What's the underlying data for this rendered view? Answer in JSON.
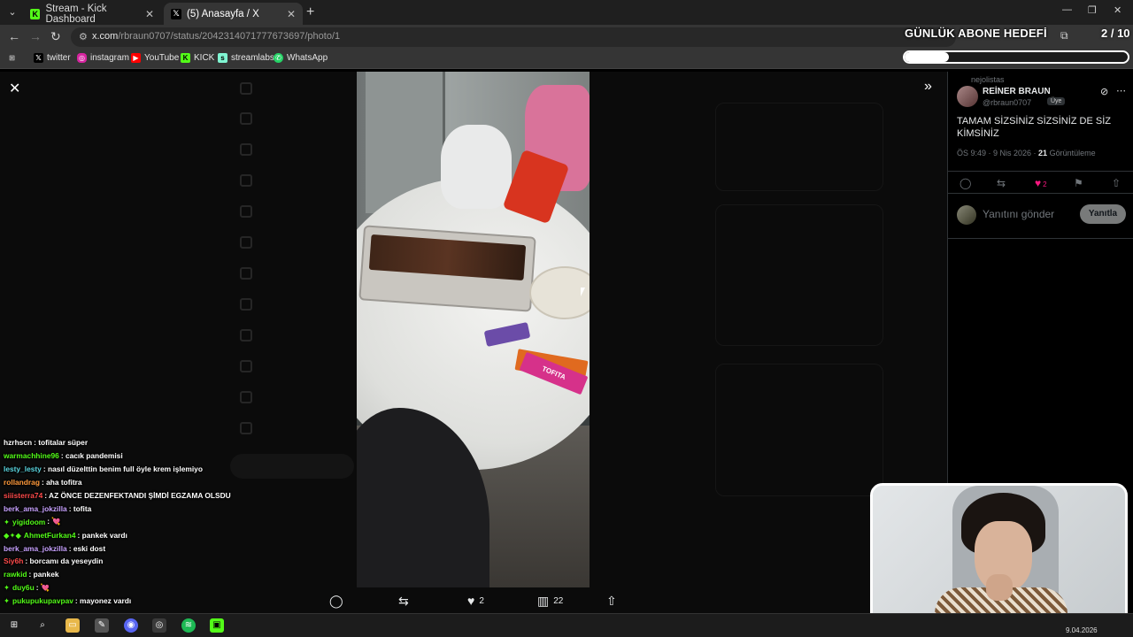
{
  "browser": {
    "tabs": [
      {
        "label": "Stream - Kick Dashboard",
        "favicon": "kick-icon",
        "active": false
      },
      {
        "label": "(5) Anasayfa / X",
        "favicon": "x-icon",
        "active": true
      }
    ],
    "url_prefix": "x.com",
    "url_path": "/rbraun0707/status/2042314071777673697/photo/1",
    "bookmarks": [
      "twitter",
      "instagram",
      "YouTube",
      "KICK",
      "streamlabs",
      "WhatsApp"
    ]
  },
  "overlay": {
    "goal_title": "GÜNLÜK ABONE HEDEFİ",
    "goal_count": "2 / 10",
    "goal_progress": 0.2
  },
  "tweet": {
    "reposted_by": "nejolistas",
    "author_name": "REİNER BRAUN",
    "author_handle": "@rbraun0707",
    "badge": "Üye",
    "text": "TAMAM SİZSİNİZ SİZSİNİZ DE SİZ KİMSİNİZ",
    "time": "ÖS 9:49 · 9 Nis 2026 · ",
    "views_count": "21",
    "views_label": " Görüntüleme",
    "likes": "2",
    "reply_placeholder": "Yanıtını gönder",
    "reply_button": "Yanıtla"
  },
  "photo_actions": {
    "likes": "2",
    "views": "22"
  },
  "chat": [
    {
      "user": "hzrhscn",
      "color": "#ffffff",
      "msg": ": tofitalar süper",
      "prefix": ""
    },
    {
      "user": "warmachhine96",
      "color": "#53fc18",
      "msg": ": cacık pandemisi",
      "prefix": ""
    },
    {
      "user": "lesty_lesty",
      "color": "#5ad6e0",
      "msg": ": nasıl düzelttin benim full öyle krem işlemiyo",
      "prefix": ""
    },
    {
      "user": "rollandrag",
      "color": "#ff9a3c",
      "msg": ": aha tofitra",
      "prefix": ""
    },
    {
      "user": "siiisterra74",
      "color": "#ff4b4b",
      "msg": ": AZ ÖNCE DEZENFEKTANDI ŞİMDİ EGZAMA OLSDU",
      "prefix": ""
    },
    {
      "user": "berk_ama_jokzilla",
      "color": "#c8a2ff",
      "msg": ": tofita",
      "prefix": ""
    },
    {
      "user": "yigidoom",
      "color": "#53fc18",
      "msg": ": 💘",
      "prefix": "✦"
    },
    {
      "user": "AhmetFurkan4",
      "color": "#53fc18",
      "msg": ": pankek vardı",
      "prefix": "◆✦◆"
    },
    {
      "user": "berk_ama_jokzilla",
      "color": "#c8a2ff",
      "msg": ": eski dost",
      "prefix": ""
    },
    {
      "user": "Siy6h",
      "color": "#ff4b4b",
      "msg": ": borcamı da yeseydin",
      "prefix": ""
    },
    {
      "user": "rawkid",
      "color": "#53fc18",
      "msg": ": pankek",
      "prefix": ""
    },
    {
      "user": "duy6u",
      "color": "#53fc18",
      "msg": ": 💘",
      "prefix": "✦"
    },
    {
      "user": "pukupukupavpav",
      "color": "#53fc18",
      "msg": ": mayonez vardı",
      "prefix": "✦"
    }
  ],
  "taskbar": {
    "date": "9.04.2026"
  }
}
